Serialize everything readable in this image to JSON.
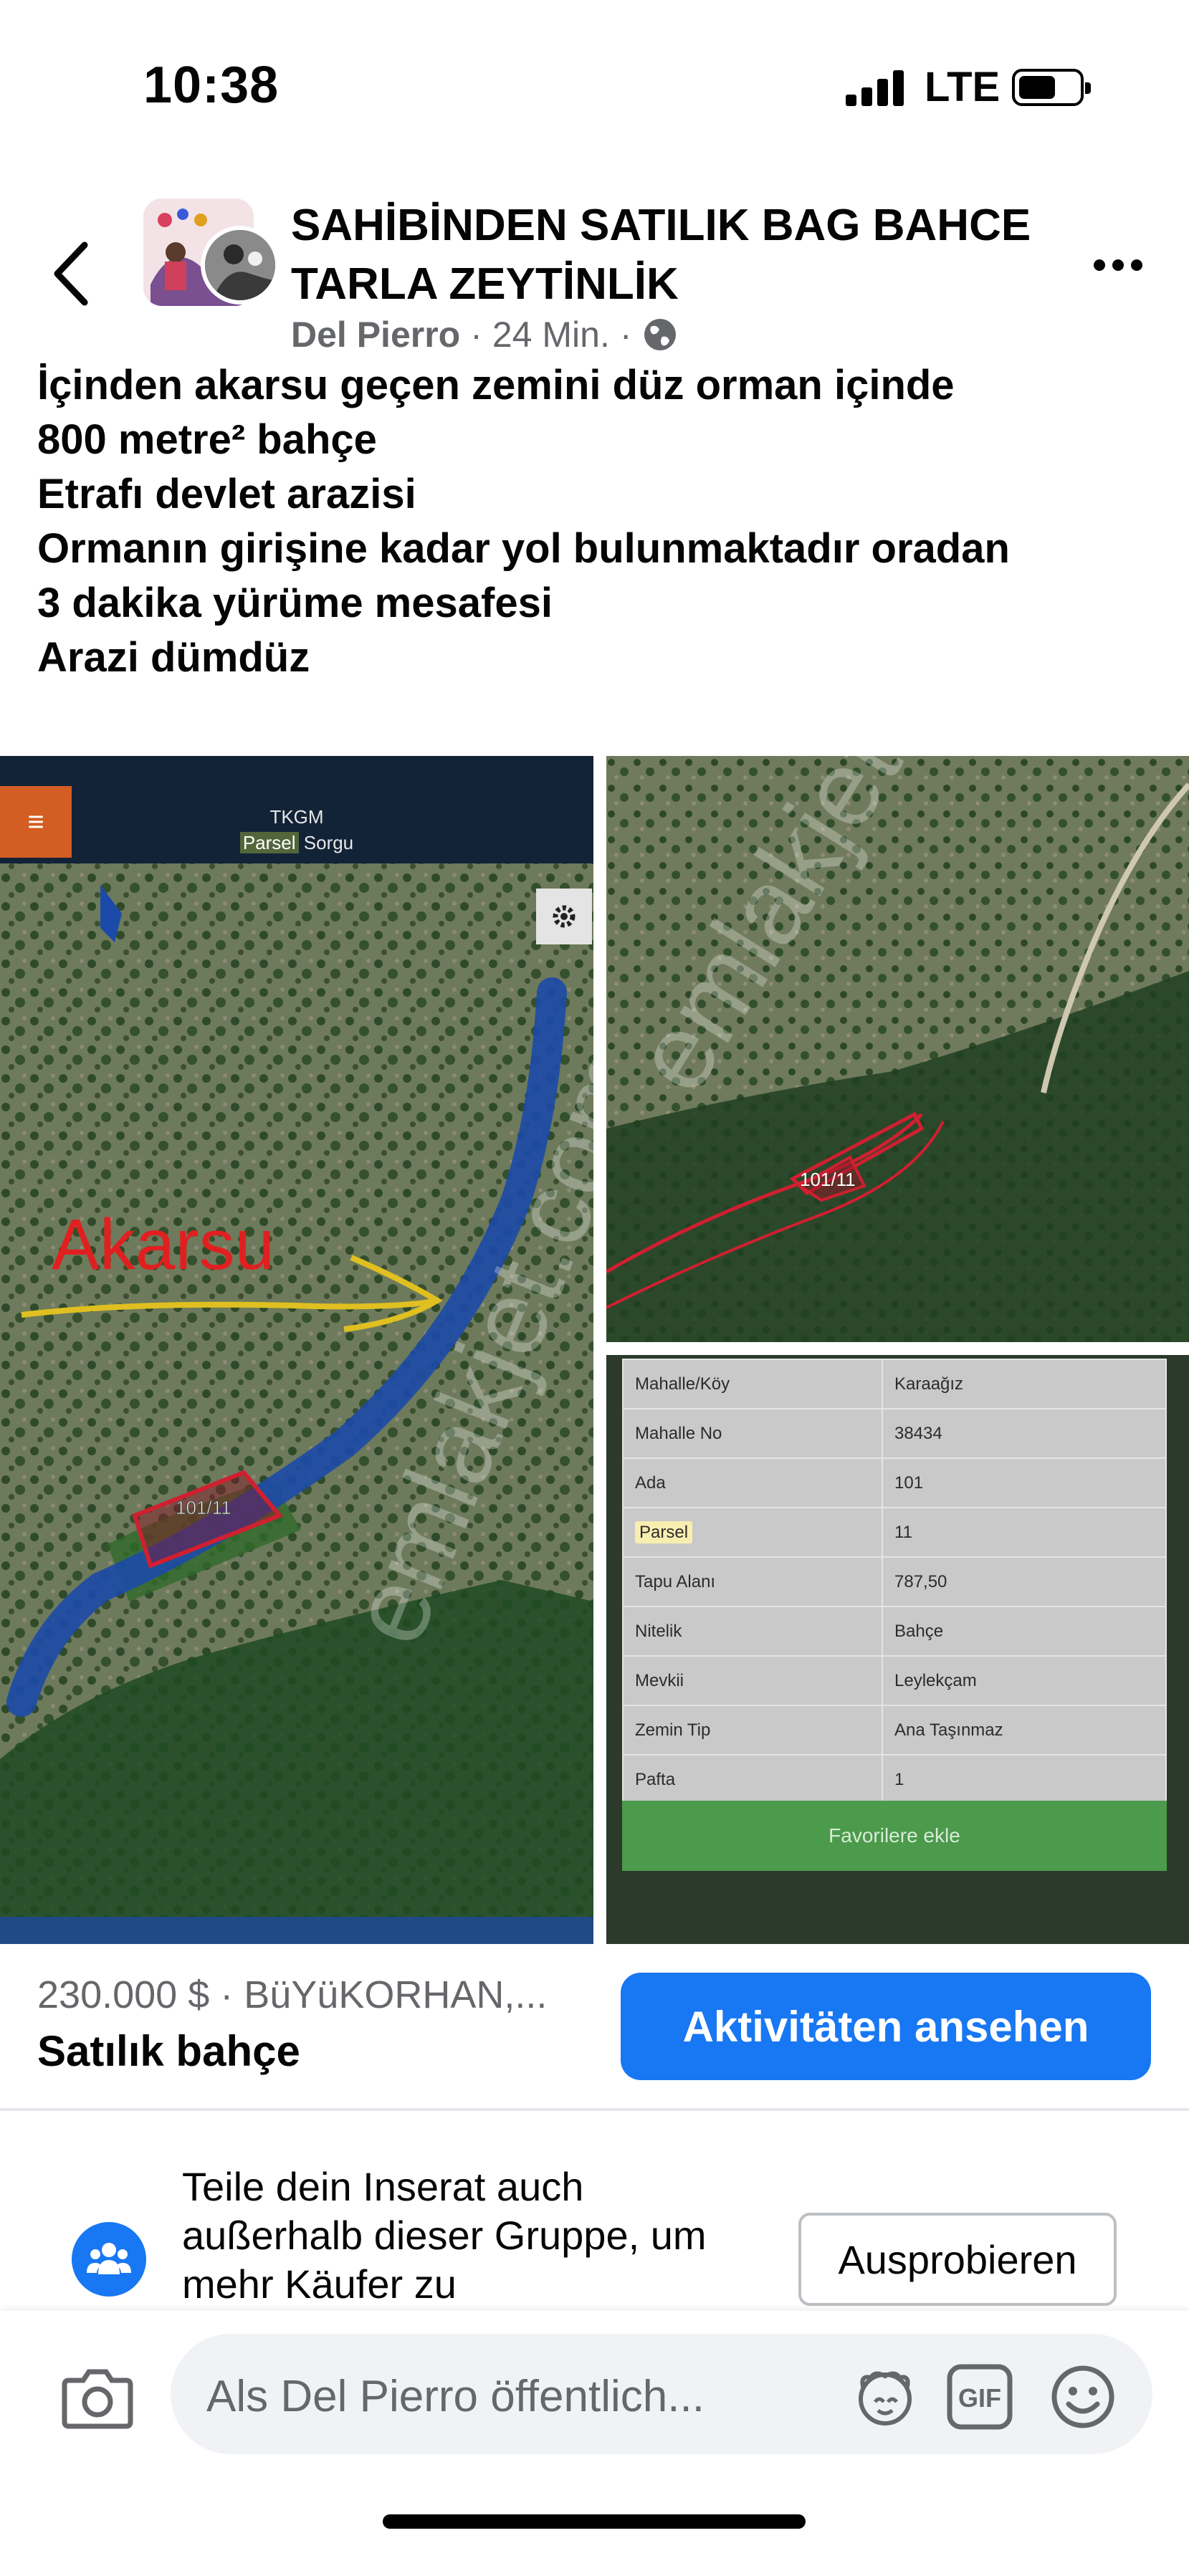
{
  "status_bar": {
    "time": "10:38",
    "network": "LTE"
  },
  "header": {
    "group_title": "SAHİBİNDEN SATILIK BAG BAHCE TARLA ZEYTİNLİK",
    "author": "Del Pierro",
    "sep1": "·",
    "time_ago": "24 Min.",
    "sep2": "·",
    "privacy_icon": "globe-icon"
  },
  "post": {
    "lines": [
      "İçinden akarsu geçen zemini düz orman içinde",
      "800 metre² bahçe",
      "Etrafı devlet arazisi",
      "Ormanın girişine kadar yol bulunmaktadır oradan",
      "3 dakika yürüme mesafesi",
      "Arazi dümdüz"
    ]
  },
  "image_left": {
    "app_title": "TKGM",
    "app_sub_highlight": "Parsel",
    "app_sub": "Sorgu",
    "annotation": "Akarsu",
    "parcel_label": "101/11",
    "watermark": "emlakjet.com"
  },
  "image_right_top": {
    "parcel_label": "101/11"
  },
  "parcel_info": {
    "rows": [
      {
        "label": "Mahalle/Köy",
        "value": "Karaağız"
      },
      {
        "label": "Mahalle No",
        "value": "38434"
      },
      {
        "label": "Ada",
        "value": "101"
      },
      {
        "label": "Parsel",
        "value": "11"
      },
      {
        "label": "Tapu Alanı",
        "value": "787,50"
      },
      {
        "label": "Nitelik",
        "value": "Bahçe"
      },
      {
        "label": "Mevkii",
        "value": "Leylekçam"
      },
      {
        "label": "Zemin Tip",
        "value": "Ana Taşınmaz"
      },
      {
        "label": "Pafta",
        "value": "1"
      }
    ],
    "favorite_button": "Favorilere ekle"
  },
  "listing": {
    "price_location": "230.000 $ · BüYüKORHAN,...",
    "title": "Satılık bahçe",
    "cta": "Aktivitäten ansehen"
  },
  "promo": {
    "text": "Teile dein Inserat auch außerhalb dieser Gruppe, um mehr Käufer zu",
    "button": "Ausprobieren"
  },
  "composer": {
    "placeholder": "Als Del Pierro öffentlich..."
  },
  "colors": {
    "facebook_blue": "#1877f2",
    "secondary_text": "#65676b",
    "annotation_red": "#e02020",
    "favorite_green": "#4c9a4c"
  }
}
